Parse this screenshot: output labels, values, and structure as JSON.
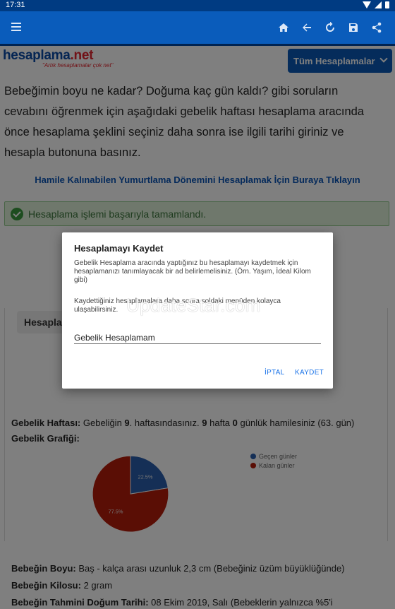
{
  "status": {
    "time": "17:31"
  },
  "appbar": {
    "icons": [
      "menu-icon",
      "home-icon",
      "back-arrow-icon",
      "refresh-icon",
      "save-icon",
      "share-icon"
    ]
  },
  "site": {
    "brand_main": "hesaplama",
    "brand_dot": ".net",
    "tagline": "\"Artık hesaplamalar çok net\"",
    "all_calculations_label": "Tüm Hesaplamalar"
  },
  "main": {
    "intro": "Bebeğimin boyu ne kadar? Doğuma kaç gün kaldı? gibi soruların cevabını öğrenmek için aşağıdaki gebelik haftası hesaplama aracında önce hesaplama şeklini seçiniz daha sonra ise ilgili tarihi giriniz ve hesapla butonuna basınız.",
    "ovulation_link": "Hamile Kalınabilen Yumurtlama Dönemini Hesaplamak İçin Buraya Tıklayın",
    "success_message": "Hesaplama işlemi başarıyla tamamlandı."
  },
  "results": {
    "tab_label": "Hesaplama Sonuçları",
    "week_label": "Gebelik Haftası:",
    "week_text_1": " Gebeliğin ",
    "week_num": "9",
    "week_text_2": ". haftasındasınız. ",
    "week_num_2": "9",
    "week_text_3": " hafta ",
    "day_num": "0",
    "week_text_4": " günlük hamilesiniz (63. gün)",
    "chart_label": "Gebelik Grafiği:",
    "baby_size_label": "Bebeğin Boyu:",
    "baby_size_value": " Baş - kalça arası uzunluk 2,3 cm (Bebeğiniz üzüm büyüklüğünde)",
    "baby_weight_label": "Bebeğin Kilosu:",
    "baby_weight_value": " 2 gram",
    "due_date_label": "Bebeğin Tahmini Doğum Tarihi:",
    "due_date_value": " 08 Ekim 2019, Salı (Bebeklerin yalnızca %5'i"
  },
  "chart_data": {
    "type": "pie",
    "categories": [
      "Geçen günler",
      "Kalan günler"
    ],
    "values": [
      22.5,
      77.5
    ],
    "labels": [
      "22.5%",
      "77.5%"
    ],
    "colors": [
      "#2b5fad",
      "#b41c0b"
    ],
    "legend_position": "top-right"
  },
  "dialog": {
    "title": "Hesaplamayı Kaydet",
    "message": "Gebelik Hesaplama aracında yaptığınız bu hesaplamayı kaydetmek için hesaplamanızı tanımlayacak bir ad belirlemelisiniz. (Örn. Yaşım, İdeal Kilom gibi)",
    "message2": "Kaydettiğiniz hesaplamalara daha sonra soldaki menüden kolayca ulaşabilirsiniz.",
    "input_value": "Gebelik Hesaplamam",
    "cancel_label": "İPTAL",
    "save_label": "KAYDET"
  },
  "watermark": "UpdateStar.com"
}
